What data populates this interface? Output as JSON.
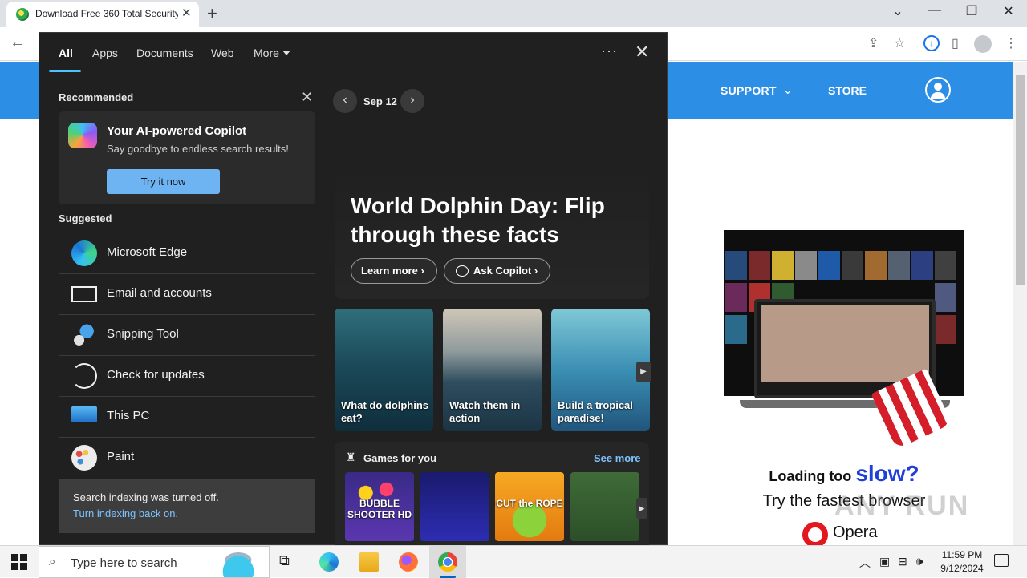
{
  "browser": {
    "tab_title": "Download Free 360 Total Security",
    "window_controls": {
      "minimize": "—",
      "restore": "❐",
      "close": "✕"
    },
    "toolbar_icons": [
      "back-arrow-icon",
      "share-icon",
      "star-icon",
      "download-icon",
      "sidebar-icon",
      "profile-icon",
      "menu-icon"
    ]
  },
  "website": {
    "nav": {
      "support": "SUPPORT",
      "store": "STORE"
    },
    "ad": {
      "loading_prefix": "Loading too ",
      "loading_emphasis": "slow?",
      "tagline": "Try the fastest browser",
      "brand": "Opera"
    }
  },
  "search_panel": {
    "tabs": [
      "All",
      "Apps",
      "Documents",
      "Web",
      "More"
    ],
    "menu_glyph": "···",
    "close_glyph": "✕",
    "recommended_label": "Recommended",
    "copilot": {
      "title": "Your AI-powered Copilot",
      "subtitle": "Say goodbye to endless search results!",
      "button": "Try it now"
    },
    "suggested_label": "Suggested",
    "suggested": [
      {
        "label": "Microsoft Edge",
        "icon": "edge-icon"
      },
      {
        "label": "Email and accounts",
        "icon": "mail-icon"
      },
      {
        "label": "Snipping Tool",
        "icon": "snipping-tool-icon"
      },
      {
        "label": "Check for updates",
        "icon": "sync-icon"
      },
      {
        "label": "This PC",
        "icon": "computer-icon"
      },
      {
        "label": "Paint",
        "icon": "paint-icon"
      }
    ],
    "indexing": {
      "message": "Search indexing was turned off.",
      "link": "Turn indexing back on."
    },
    "date_label": "Sep 12",
    "hero": {
      "title": "World Dolphin Day: Flip through these facts",
      "learn_more": "Learn more",
      "ask_copilot": "Ask Copilot"
    },
    "tiles": [
      {
        "caption": "What do dolphins eat?"
      },
      {
        "caption": "Watch them in action"
      },
      {
        "caption": "Build a tropical paradise!"
      }
    ],
    "games": {
      "title": "Games for you",
      "see_more": "See more",
      "items": [
        {
          "name": "BUBBLE SHOOTER HD"
        },
        {
          "name": ""
        },
        {
          "name": "CUT the ROPE"
        },
        {
          "name": ""
        }
      ]
    }
  },
  "taskbar": {
    "search_placeholder": "Type here to search",
    "time": "11:59 PM",
    "date": "9/12/2024"
  },
  "watermark": "ANY RUN"
}
